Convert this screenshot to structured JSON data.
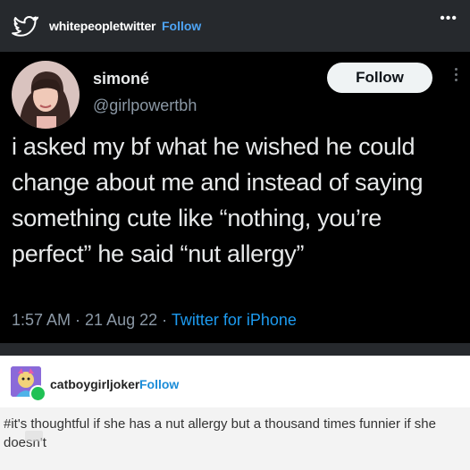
{
  "post": {
    "username": "whitepeopletwitter",
    "follow_label": "Follow",
    "more_label": "•••"
  },
  "tweet": {
    "display_name": "simoné",
    "handle": "@girlpowertbh",
    "follow_label": "Follow",
    "text": "i asked my bf what he wished he could change about me and instead of saying something cute like “nothing, you’re perfect” he said “nut allergy”",
    "time": "1:57 AM",
    "date": "21 Aug 22",
    "source": "Twitter for iPhone",
    "separator": " · "
  },
  "reblog": {
    "username": "catboygirljoker",
    "follow_label": "Follow",
    "comment": "#it's thoughtful if she has a nut allergy but a thousand times funnier if she doesn't"
  },
  "colors": {
    "tumblr_bg": "#26292d",
    "tweet_bg": "#000000",
    "link_blue": "#1d9bf0",
    "tag_bg": "#f3f3f3"
  },
  "icons": [
    "twitter-bird-icon",
    "more-dots-icon",
    "tweet-more-icon",
    "avatar",
    "reblog-badge-icon"
  ]
}
